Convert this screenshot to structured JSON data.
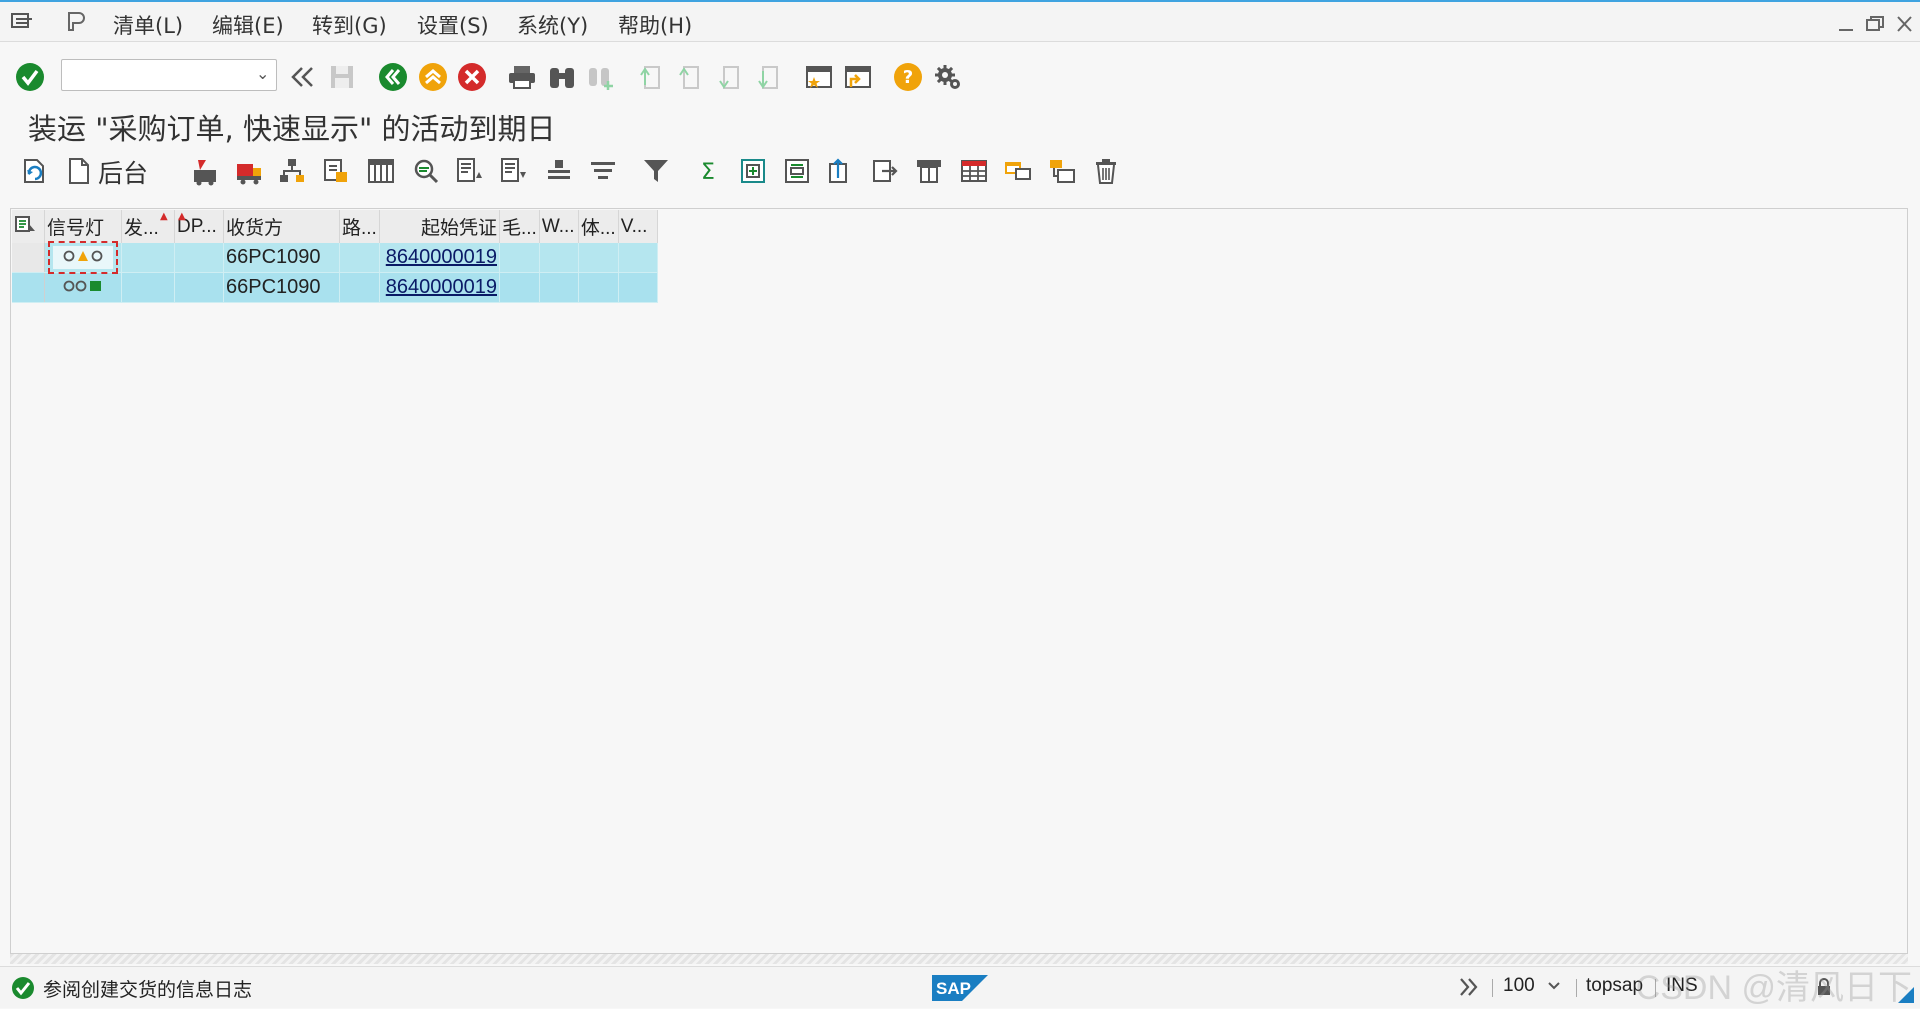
{
  "menubar": {
    "items": [
      "清单(L)",
      "编辑(E)",
      "转到(G)",
      "设置(S)",
      "系统(Y)",
      "帮助(H)"
    ]
  },
  "toolbar": {
    "command_value": ""
  },
  "page_title": "装运 \"采购订单, 快速显示\" 的活动到期日",
  "app_toolbar": {
    "background_label": "后台"
  },
  "table": {
    "headers": [
      "信号灯",
      "发...",
      "DP...",
      "收货方",
      "路...",
      "起始凭证",
      "毛...",
      "W...",
      "体...",
      "V..."
    ],
    "rows": [
      {
        "traffic_light": "yellow",
        "ship_to": "66PC1090",
        "source_doc": "8640000019"
      },
      {
        "traffic_light": "green",
        "ship_to": "66PC1090",
        "source_doc": "8640000019"
      }
    ]
  },
  "statusbar": {
    "message": "参阅创建交货的信息日志",
    "zoom": "100",
    "system": "topsap",
    "mode": "INS",
    "brand": "SAP"
  },
  "watermark": "CSDN @清风日下",
  "colors": {
    "accent": "#3fa3e0",
    "row_highlight": "#b5e6ef",
    "ok_green": "#1a8a2e",
    "cancel_red": "#d42b2b",
    "warning_orange": "#f0a30a"
  }
}
